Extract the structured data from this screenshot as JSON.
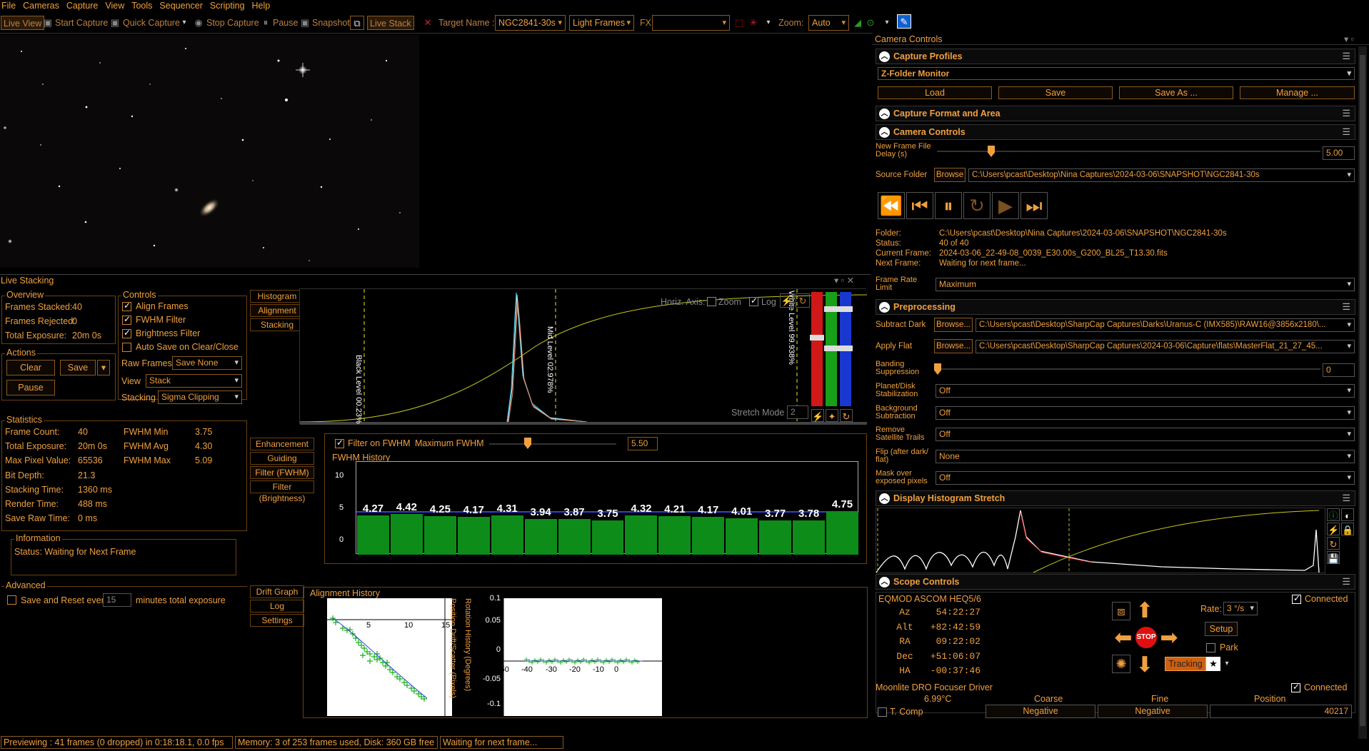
{
  "menu": [
    "File",
    "Cameras",
    "Capture",
    "View",
    "Tools",
    "Sequencer",
    "Scripting",
    "Help"
  ],
  "toolbar": {
    "live_view": "Live View",
    "start_capture": "Start Capture",
    "quick_capture": "Quick Capture",
    "stop_capture": "Stop Capture",
    "pause": "Pause",
    "snapshot": "Snapshot",
    "live_stack": "Live Stack",
    "target_name_label": "Target Name :",
    "target_name": "NGC2841-30s",
    "frame_type": "Light Frames",
    "fx_label": "FX",
    "fx_value": "",
    "zoom_label": "Zoom:",
    "zoom_value": "Auto"
  },
  "live_stacking": {
    "title": "Live Stacking",
    "overview": {
      "title": "Overview",
      "frames_stacked_label": "Frames Stacked:",
      "frames_stacked": "40",
      "frames_rejected_label": "Frames Rejected:",
      "frames_rejected": "0",
      "total_exposure_label": "Total Exposure:",
      "total_exposure": "20m 0s"
    },
    "controls": {
      "title": "Controls",
      "align_frames": "Align Frames",
      "fwhm_filter": "FWHM Filter",
      "brightness_filter": "Brightness Filter",
      "auto_save": "Auto Save on Clear/Close",
      "raw_frames_label": "Raw Frames",
      "raw_frames": "Save None",
      "view_label": "View",
      "view": "Stack",
      "stacking_label": "Stacking",
      "stacking": "Sigma Clipping"
    },
    "actions": {
      "title": "Actions",
      "clear": "Clear",
      "save": "Save",
      "pause": "Pause"
    },
    "statistics": {
      "title": "Statistics",
      "rows": [
        {
          "label": "Frame Count:",
          "value": "40"
        },
        {
          "label": "Total Exposure:",
          "value": "20m 0s"
        },
        {
          "label": "Max Pixel Value:",
          "value": "65536"
        },
        {
          "label": "Bit Depth:",
          "value": "21.3"
        },
        {
          "label": "Stacking Time:",
          "value": "1360 ms"
        },
        {
          "label": "Render Time:",
          "value": "488 ms"
        },
        {
          "label": "Save Raw Time:",
          "value": "0 ms"
        }
      ],
      "fwhm": [
        {
          "label": "FWHM Min",
          "value": "3.75"
        },
        {
          "label": "FWHM Avg",
          "value": "4.30"
        },
        {
          "label": "FWHM Max",
          "value": "5.09"
        }
      ]
    },
    "information": {
      "title": "Information",
      "status": "Status: Waiting for Next Frame"
    },
    "advanced": {
      "title": "Advanced",
      "save_reset": "Save and Reset every",
      "minutes": "15",
      "suffix": "minutes total exposure"
    },
    "tabs_top": [
      "Histogram",
      "Alignment",
      "Stacking"
    ],
    "tabs_mid": [
      "Enhancement",
      "Guiding",
      "Filter (FWHM)",
      "Filter (Brightness)"
    ],
    "tabs_bottom": [
      "Drift Graph",
      "Log",
      "Settings"
    ],
    "histogram": {
      "horiz_axis": "Horiz. Axis:",
      "zoom": "Zoom",
      "log": "Log",
      "black_level": "Black Level  00.23%",
      "mid_level": "Mid Level  02.978%",
      "white_level": "White Level  99.938%",
      "stretch_mode": "Stretch Mode",
      "stretch_value": "2"
    },
    "fwhm_filter": {
      "filter_on": "Filter on FWHM",
      "max_label": "Maximum FWHM",
      "max_value": "5.50",
      "history_title": "FWHM History",
      "y_ticks": [
        "10",
        "5",
        "0"
      ],
      "values": [
        "4.27",
        "4.42",
        "4.25",
        "4.17",
        "4.31",
        "3.94",
        "3.87",
        "3.75",
        "4.32",
        "4.21",
        "4.17",
        "4.01",
        "3.77",
        "3.78",
        "4.75"
      ]
    },
    "alignment_history": {
      "title": "Alignment History",
      "pos_label": "Position Drift/Scatter (Pixels)",
      "rot_label": "Rotation History (Degrees)",
      "pos_x_ticks": [
        "5",
        "10",
        "15"
      ],
      "pos_y_ticks": [
        "-5",
        "-10"
      ],
      "rot_y_ticks": [
        "0.1",
        "0.05",
        "0",
        "-0.05",
        "-0.1"
      ],
      "rot_x_ticks": [
        "-50",
        "-40",
        "-30",
        "-20",
        "-10",
        "0"
      ]
    }
  },
  "camera_controls_panel": {
    "title": "Camera Controls",
    "capture_profiles": {
      "title": "Capture Profiles",
      "profile": "Z-Folder Monitor",
      "load": "Load",
      "save": "Save",
      "save_as": "Save As ...",
      "manage": "Manage ..."
    },
    "capture_format": {
      "title": "Capture Format and Area"
    },
    "camera_controls": {
      "title": "Camera Controls",
      "new_frame_label": "New Frame File Delay (s)",
      "new_frame_value": "5.00",
      "source_folder_label": "Source Folder",
      "browse": "Browse",
      "source_folder": "C:\\Users\\pcast\\Desktop\\Nina Captures\\2024-03-06\\SNAPSHOT\\NGC2841-30s",
      "folder_label": "Folder:",
      "folder": "C:\\Users\\pcast\\Desktop\\Nina Captures\\2024-03-06\\SNAPSHOT\\NGC2841-30s",
      "status_label": "Status:",
      "status": "40 of 40",
      "current_frame_label": "Current Frame:",
      "current_frame": "2024-03-06_22-49-08_0039_E30.00s_G200_BL25_T13.30.fits",
      "next_frame_label": "Next Frame:",
      "next_frame": "Waiting for next frame...",
      "frame_rate_label": "Frame Rate Limit",
      "frame_rate": "Maximum"
    },
    "preprocessing": {
      "title": "Preprocessing",
      "subtract_dark_label": "Subtract Dark",
      "browse": "Browse...",
      "subtract_dark": "C:\\Users\\pcast\\Desktop\\SharpCap Captures\\Darks\\Uranus-C (IMX585)\\RAW16@3856x2180\\...",
      "apply_flat_label": "Apply Flat",
      "apply_flat": "C:\\Users\\pcast\\Desktop\\SharpCap Captures\\2024-03-06\\Capture\\flats\\MasterFlat_21_27_45...",
      "banding_label": "Banding Suppression",
      "banding_value": "0",
      "rows": [
        {
          "label": "Planet/Disk Stabilization",
          "value": "Off"
        },
        {
          "label": "Background Subtraction",
          "value": "Off"
        },
        {
          "label": "Remove Satellite Trails",
          "value": "Off"
        },
        {
          "label": "Flip (after dark/ flat)",
          "value": "None"
        },
        {
          "label": "Mask over exposed pixels",
          "value": "Off"
        }
      ]
    },
    "display_histogram": {
      "title": "Display Histogram Stretch"
    },
    "scope_controls": {
      "title": "Scope Controls",
      "mount": "EQMOD ASCOM HEQ5/6",
      "connected": "Connected",
      "coords": [
        {
          "label": "Az",
          "value": "54:22:27"
        },
        {
          "label": "Alt",
          "value": "+82:42:59"
        },
        {
          "label": "RA",
          "value": "09:22:02"
        },
        {
          "label": "Dec",
          "value": "+51:06:07"
        },
        {
          "label": "HA",
          "value": "-00:37:46"
        }
      ],
      "rate_label": "Rate:",
      "rate": "3 °/s",
      "setup": "Setup",
      "park": "Park",
      "stop": "STOP",
      "tracking": "Tracking"
    },
    "focuser": {
      "name": "Moonlite DRO Focuser Driver",
      "connected": "Connected",
      "temp": "6.99°C",
      "t_comp": "T. Comp",
      "coarse": "Coarse",
      "fine": "Fine",
      "position": "Position",
      "negative": "Negative",
      "negative2": "Negative",
      "position_value": "40217"
    }
  },
  "statusbar": {
    "preview": "Previewing : 41 frames (0 dropped) in 0:18:18.1, 0.0 fps",
    "memory": "Memory: 3 of 253 frames used, Disk: 360 GB free",
    "waiting": "Waiting for next frame..."
  },
  "colors": {
    "accent": "#f0a040",
    "fwhm_bar": "#0e8c1a",
    "border": "#8a5a20"
  }
}
